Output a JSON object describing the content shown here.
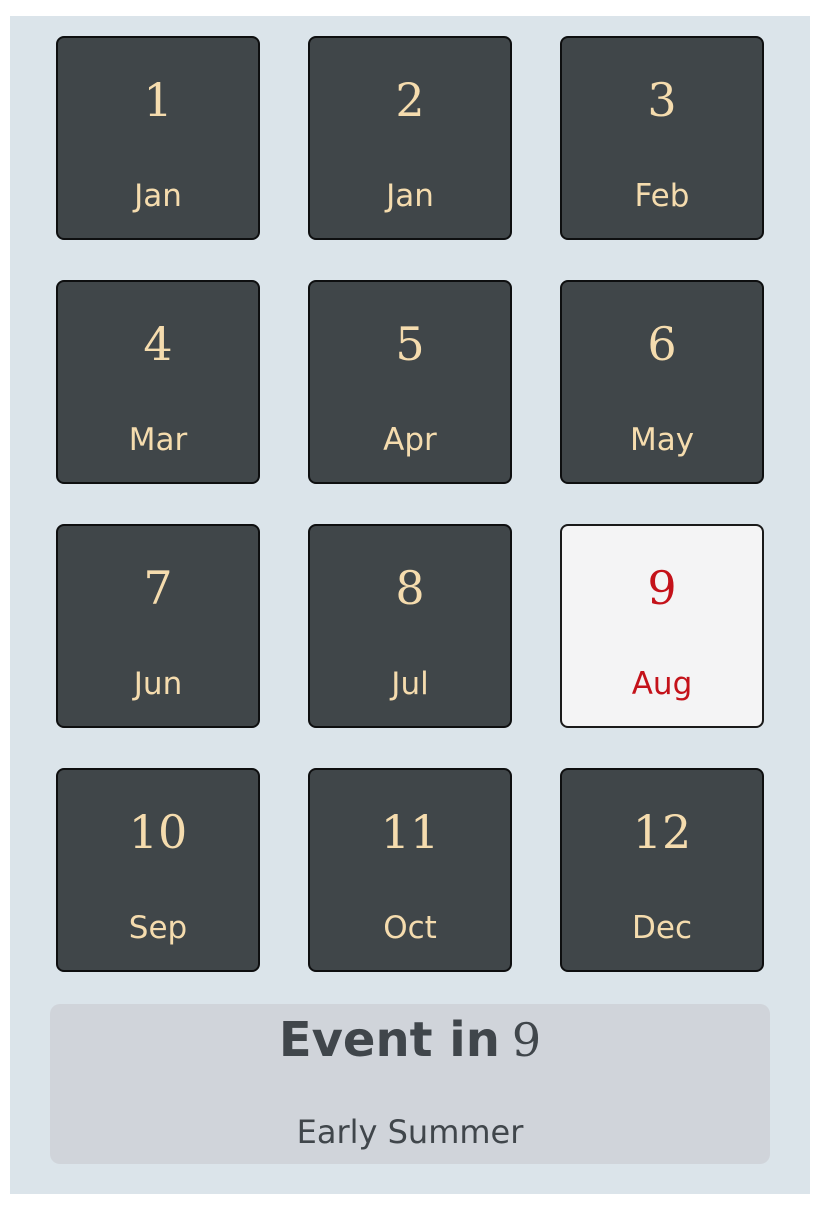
{
  "calendar": {
    "selected_index": 8,
    "tiles": [
      {
        "number": "1",
        "month": "Jan"
      },
      {
        "number": "2",
        "month": "Jan"
      },
      {
        "number": "3",
        "month": "Feb"
      },
      {
        "number": "4",
        "month": "Mar"
      },
      {
        "number": "5",
        "month": "Apr"
      },
      {
        "number": "6",
        "month": "May"
      },
      {
        "number": "7",
        "month": "Jun"
      },
      {
        "number": "8",
        "month": "Jul"
      },
      {
        "number": "9",
        "month": "Aug"
      },
      {
        "number": "10",
        "month": "Sep"
      },
      {
        "number": "11",
        "month": "Oct"
      },
      {
        "number": "12",
        "month": "Dec"
      }
    ]
  },
  "event": {
    "heading_prefix": "Event in",
    "heading_value": "9",
    "caption": "Early Summer"
  },
  "colors": {
    "panel_background": "#dbe4ea",
    "tile_background": "#404649",
    "tile_text": "#f5dcae",
    "selected_background": "#f4f4f5",
    "selected_text": "#c4121a",
    "footer_background": "#d0d4da",
    "footer_text": "#40464b"
  }
}
